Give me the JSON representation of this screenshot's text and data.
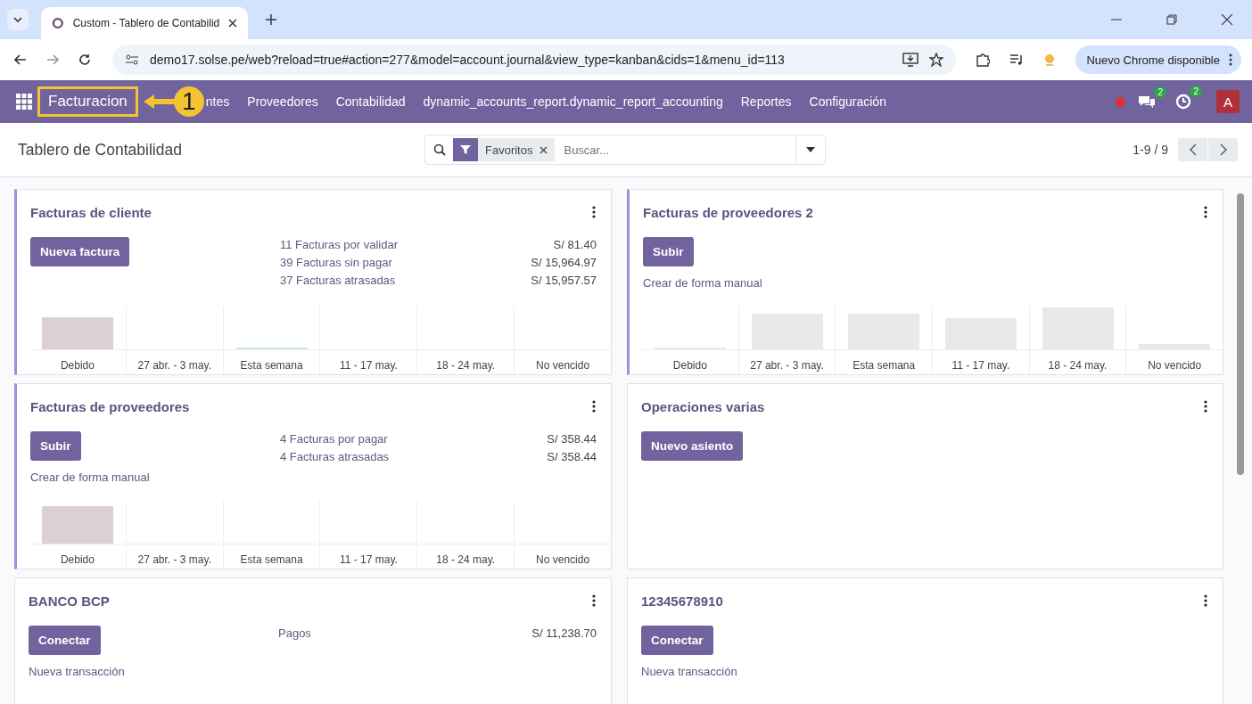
{
  "browser": {
    "tab_title": "Custom - Tablero de Contabilid",
    "url": "demo17.solse.pe/web?reload=true#action=277&model=account.journal&view_type=kanban&cids=1&menu_id=113",
    "update_button": "Nuevo Chrome disponible"
  },
  "navbar": {
    "app_name": "Facturacion",
    "callout_number": "1",
    "menu": [
      "ntes",
      "Proveedores",
      "Contabilidad",
      "dynamic_accounts_report.dynamic_report_accounting",
      "Reportes",
      "Configuración"
    ],
    "messages_count": "2",
    "activities_count": "2",
    "avatar_letter": "A"
  },
  "control_panel": {
    "title": "Tablero de Contabilidad",
    "filter_facet": "Favoritos",
    "search_placeholder": "Buscar...",
    "pager": "1-9 / 9"
  },
  "cards": [
    {
      "title": "Facturas de cliente",
      "kind": "invoices",
      "accent": true,
      "button": "Nueva factura",
      "stats": [
        {
          "label": "11 Facturas por validar",
          "amount": "S/ 81.40"
        },
        {
          "label": "39 Facturas sin pagar",
          "amount": "S/ 15,964.97"
        },
        {
          "label": "37 Facturas atrasadas",
          "amount": "S/ 15,957.57"
        }
      ],
      "graph_labels": [
        "Debido",
        "27 abr. - 3 may.",
        "Esta semana",
        "11 - 17 may.",
        "18 - 24 may.",
        "No vencido"
      ]
    },
    {
      "title": "Facturas de proveedores 2",
      "kind": "invoices",
      "accent": true,
      "button": "Subir",
      "link": "Crear de forma manual",
      "graph_labels": [
        "Debido",
        "27 abr. - 3 may.",
        "Esta semana",
        "11 - 17 may.",
        "18 - 24 may.",
        "No vencido"
      ]
    },
    {
      "title": "Facturas de proveedores",
      "kind": "invoices",
      "accent": true,
      "button": "Subir",
      "link": "Crear de forma manual",
      "stats": [
        {
          "label": "4 Facturas por pagar",
          "amount": "S/ 358.44"
        },
        {
          "label": "4 Facturas atrasadas",
          "amount": "S/ 358.44"
        }
      ],
      "graph_labels": [
        "Debido",
        "27 abr. - 3 may.",
        "Esta semana",
        "11 - 17 may.",
        "18 - 24 may.",
        "No vencido"
      ]
    },
    {
      "title": "Operaciones varias",
      "kind": "general",
      "accent": false,
      "button": "Nuevo asiento"
    },
    {
      "title": "BANCO BCP",
      "kind": "bank",
      "accent": false,
      "button": "Conectar",
      "link": "Nueva transacción",
      "stats": [
        {
          "label": "Pagos",
          "amount": "S/ 11,238.70"
        }
      ]
    },
    {
      "title": "12345678910",
      "kind": "bank",
      "accent": false,
      "button": "Conectar",
      "link": "Nueva transacción"
    }
  ]
}
